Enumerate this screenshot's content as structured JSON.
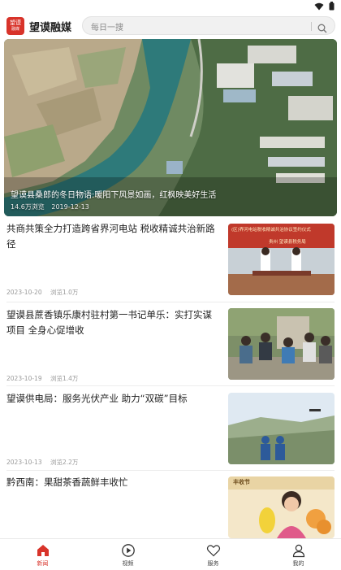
{
  "app": {
    "logo_top": "望谟",
    "logo_bottom": "融媒",
    "title": "望谟融媒"
  },
  "search": {
    "placeholder": "每日一搜"
  },
  "hero": {
    "caption": "望谟县桑郎的冬日物语:暖阳下风景如画，红枫映美好生活",
    "views": "14.6万浏览",
    "date": "2019-12-13"
  },
  "news": [
    {
      "title": "共商共策全力打造跨省界河电站 税收精诚共治新路径",
      "date": "2023-10-20",
      "views": "浏览1.0万",
      "thumb": "meeting"
    },
    {
      "title": "望谟县蔗香镇乐康村驻村第一书记单乐：实打实谋项目 全身心促增收",
      "date": "2023-10-19",
      "views": "浏览1.4万",
      "thumb": "village"
    },
    {
      "title": "望谟供电局：服务光伏产业 助力“双碳”目标",
      "date": "2023-10-13",
      "views": "浏览2.2万",
      "thumb": "solar"
    },
    {
      "title": "黔西南：果甜茶香蔬鲜丰收忙",
      "date": "",
      "views": "",
      "thumb": "harvest"
    }
  ],
  "thumb_texts": {
    "meeting_banner": "(区)界河电站税收精诚共治协议签约仪式",
    "meeting_banner2": "贵州 望谟县税务局",
    "harvest_banner": "丰收节"
  },
  "nav": [
    {
      "label": "新闻",
      "icon": "home-icon",
      "active": true
    },
    {
      "label": "视频",
      "icon": "play-icon",
      "active": false
    },
    {
      "label": "服务",
      "icon": "heart-icon",
      "active": false
    },
    {
      "label": "我的",
      "icon": "user-icon",
      "active": false
    }
  ],
  "colors": {
    "accent": "#d8332a",
    "text": "#222222",
    "meta": "#999999"
  }
}
